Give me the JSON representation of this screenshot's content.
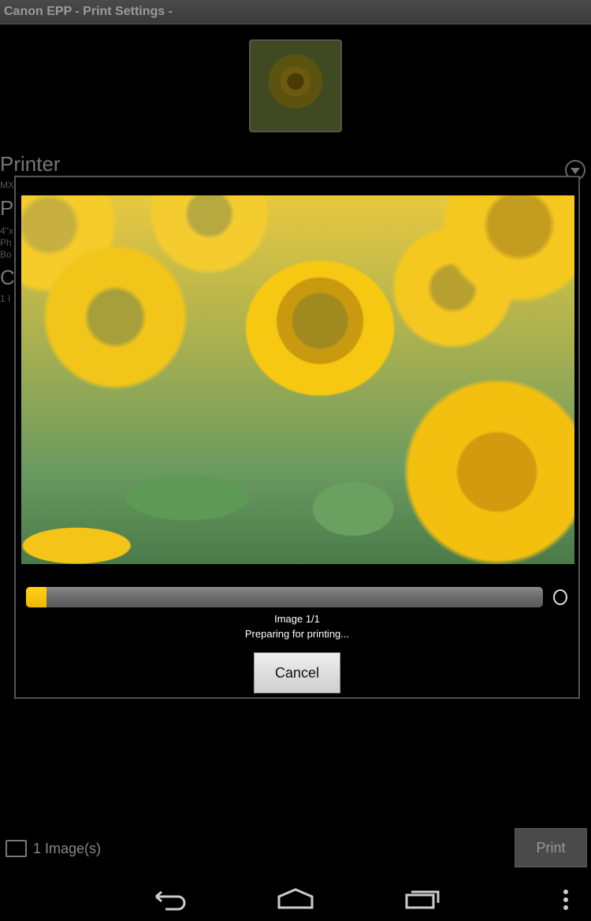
{
  "title": "Canon EPP  - Print Settings -",
  "background": {
    "printer_label": "Printer",
    "printer_value": "MX",
    "paper_label": "P",
    "paper_lines": [
      "4\"x",
      "Ph",
      "Bo"
    ],
    "copies_label": "C",
    "copies_value": "1 I"
  },
  "dialog": {
    "progress_percent": 4,
    "image_counter": "Image 1/1",
    "status_text": "Preparing for printing...",
    "cancel_label": "Cancel"
  },
  "footer": {
    "image_count": "1 Image(s)",
    "print_label": "Print"
  },
  "colors": {
    "accent": "#f5c400"
  }
}
